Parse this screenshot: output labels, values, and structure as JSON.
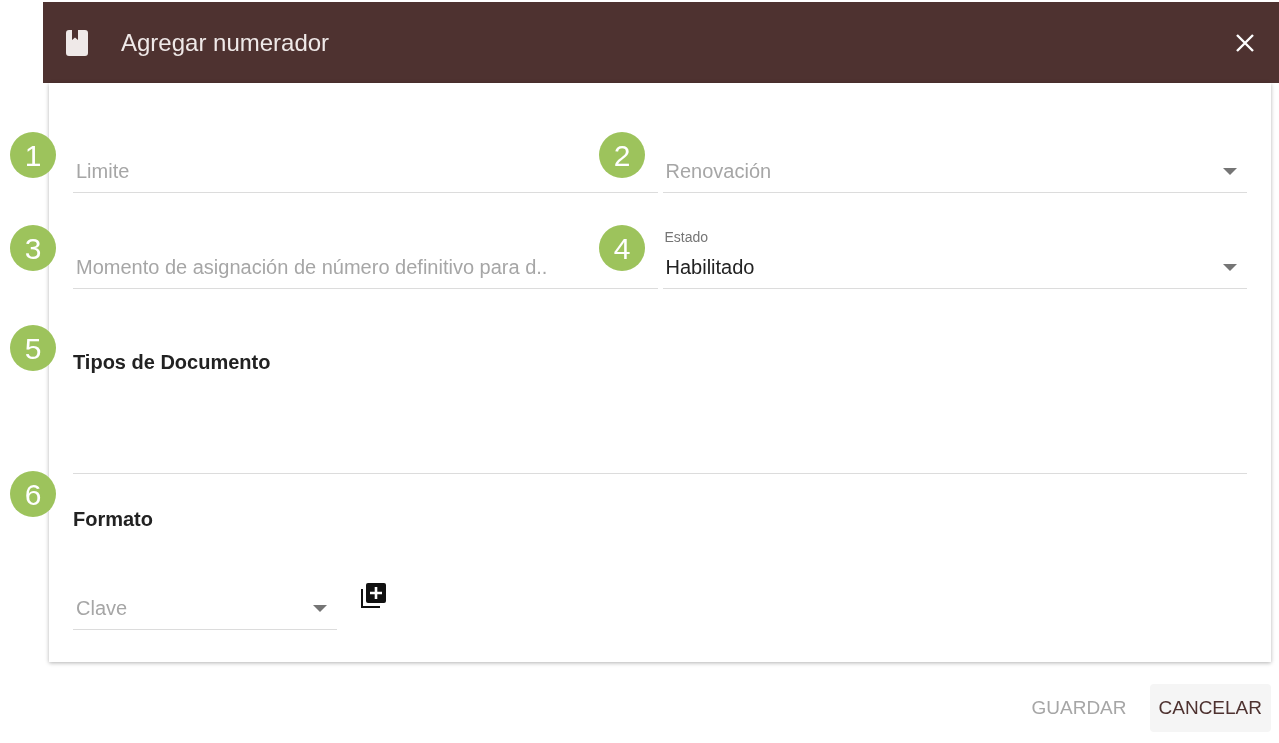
{
  "dialog": {
    "title": "Agregar numerador"
  },
  "field_rows": [
    {
      "fields": [
        {
          "kind": "text",
          "placeholder": "Limite"
        },
        {
          "kind": "select",
          "placeholder": "Renovación"
        }
      ]
    },
    {
      "fields": [
        {
          "kind": "text",
          "placeholder": "Momento de asignación de número definitivo para d.."
        },
        {
          "kind": "select",
          "label": "Estado",
          "value": "Habilitado"
        }
      ]
    }
  ],
  "sections": [
    {
      "title": "Tipos de Documento"
    },
    {
      "title": "Formato"
    }
  ],
  "format": {
    "field": {
      "kind": "select",
      "placeholder": "Clave"
    }
  },
  "buttons": [
    {
      "label": "GUARDAR",
      "disabled": true
    },
    {
      "label": "CANCELAR",
      "disabled": false
    }
  ],
  "callouts": [
    "1",
    "2",
    "3",
    "4",
    "5",
    "6"
  ]
}
